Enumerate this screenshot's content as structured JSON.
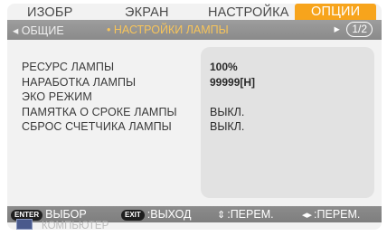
{
  "tabs": [
    {
      "label": "ИЗОБР"
    },
    {
      "label": "ЭКРАН"
    },
    {
      "label": "НАСТРОЙКА"
    },
    {
      "label": "ОПЦИИ"
    }
  ],
  "subbar": {
    "left": "◂ ОБЩИЕ",
    "current": "• НАСТРОЙКИ ЛАМПЫ",
    "arrow": "▸",
    "page": "1/2"
  },
  "rows": [
    {
      "label": "РЕСУРС ЛАМПЫ",
      "value": "100%"
    },
    {
      "label": "НАРАБОТКА ЛАМПЫ",
      "value": "99999[H]"
    },
    {
      "label": "ЭКО РЕЖИМ",
      "value": ""
    },
    {
      "label": "ПАМЯТКА О СРОКЕ ЛАМПЫ",
      "value": "ВЫКЛ."
    },
    {
      "label": "СБРОС СЧЕТЧИКА ЛАМПЫ",
      "value": "ВЫКЛ."
    }
  ],
  "footer": {
    "enter_key": "ENTER",
    "enter_label": "ВЫБОР",
    "exit_key": "EXIT",
    "exit_label": ":ВЫХОД",
    "updown_label": ":ПЕРЕМ.",
    "leftright_label": ":ПЕРЕМ."
  },
  "source": {
    "label": "КОМПЬЮТЕР"
  },
  "colors": {
    "accent": "#f7a41c",
    "bar": "#8a8a8a"
  }
}
